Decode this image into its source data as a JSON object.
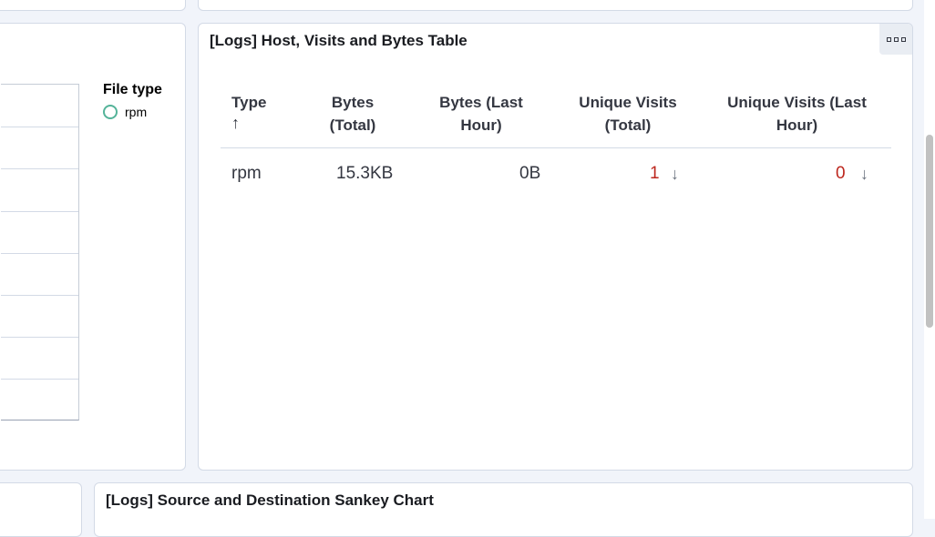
{
  "legend": {
    "title": "File type",
    "items": [
      {
        "label": "rpm",
        "color": "#54b399"
      }
    ]
  },
  "table_panel": {
    "title": "[Logs] Host, Visits and Bytes Table",
    "options_icon": "options-menu-icon",
    "columns": [
      "Type",
      "Bytes (Total)",
      "Bytes (Last Hour)",
      "Unique Visits (Total)",
      "Unique Visits (Last Hour)"
    ],
    "sort_icon": "↑",
    "rows": [
      {
        "type": "rpm",
        "bytes_total": "15.3KB",
        "bytes_last_hour": "0B",
        "visits_total": "1",
        "visits_last_hour": "0",
        "trend_icon": "↓"
      }
    ]
  },
  "sankey_panel": {
    "title": "[Logs] Source and Destination Sankey Chart"
  },
  "colors": {
    "negative": "#bd271e",
    "accent": "#54b399"
  }
}
